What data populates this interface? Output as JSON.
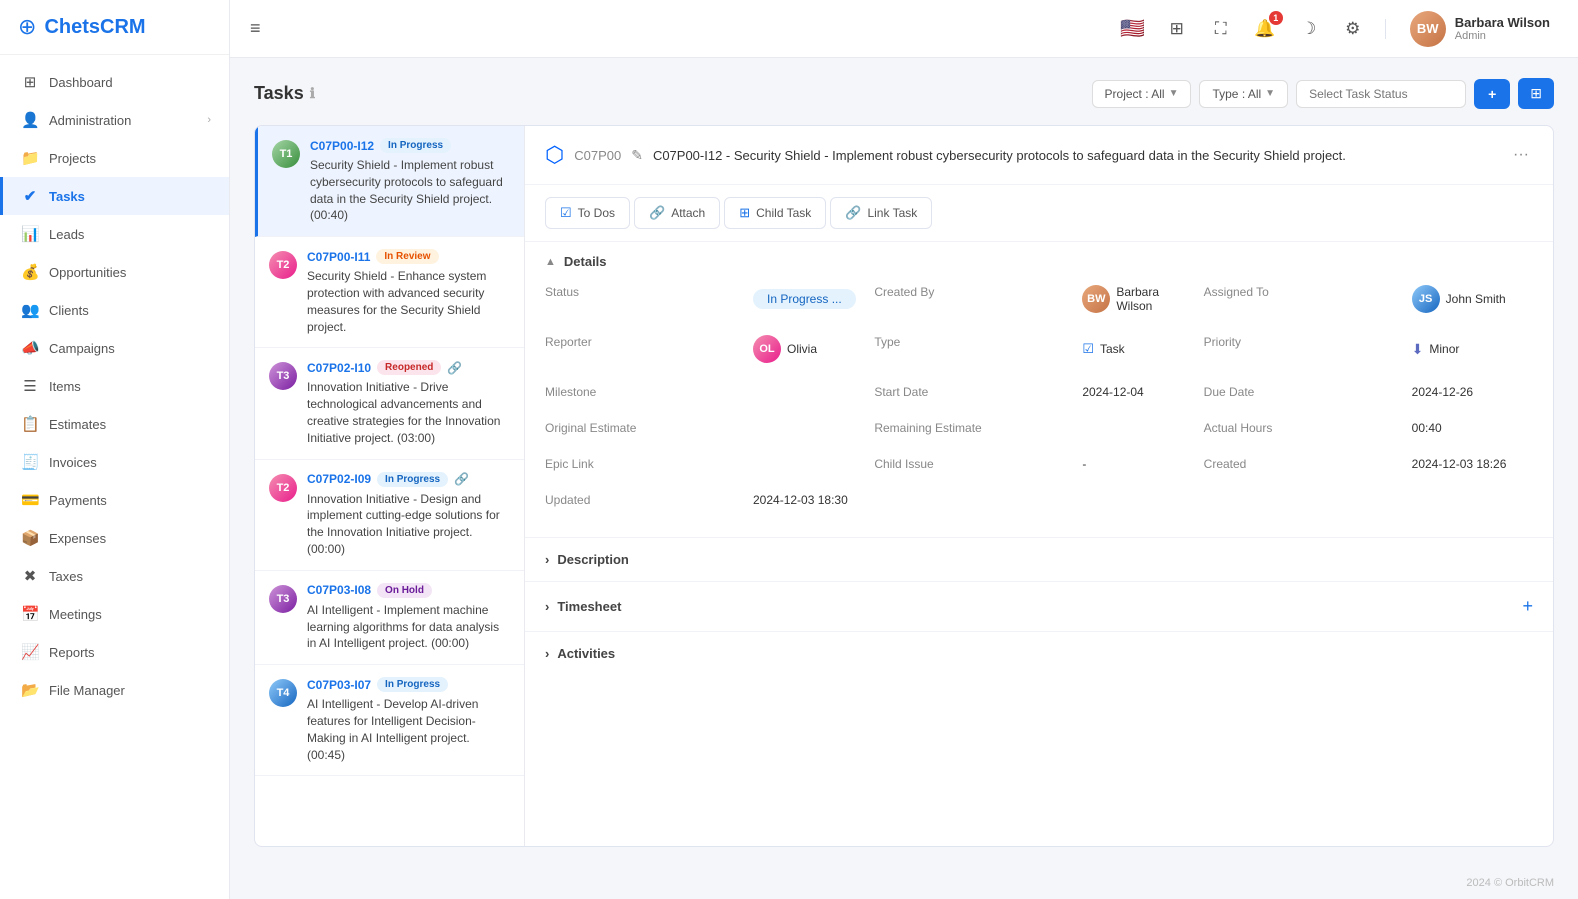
{
  "app": {
    "name": "ChetsCRM",
    "logo_symbol": "⊕"
  },
  "topbar": {
    "hamburger": "≡",
    "user": {
      "name": "Barbara Wilson",
      "role": "Admin",
      "initials": "BW"
    },
    "notification_count": "1"
  },
  "sidebar": {
    "items": [
      {
        "id": "dashboard",
        "label": "Dashboard",
        "icon": "⊞"
      },
      {
        "id": "administration",
        "label": "Administration",
        "icon": "👤",
        "has_arrow": true
      },
      {
        "id": "projects",
        "label": "Projects",
        "icon": "📁"
      },
      {
        "id": "tasks",
        "label": "Tasks",
        "icon": "✔",
        "active": true
      },
      {
        "id": "leads",
        "label": "Leads",
        "icon": "📊"
      },
      {
        "id": "opportunities",
        "label": "Opportunities",
        "icon": "💰"
      },
      {
        "id": "clients",
        "label": "Clients",
        "icon": "👥"
      },
      {
        "id": "campaigns",
        "label": "Campaigns",
        "icon": "📣"
      },
      {
        "id": "items",
        "label": "Items",
        "icon": "☰"
      },
      {
        "id": "estimates",
        "label": "Estimates",
        "icon": "📋"
      },
      {
        "id": "invoices",
        "label": "Invoices",
        "icon": "🧾"
      },
      {
        "id": "payments",
        "label": "Payments",
        "icon": "💳"
      },
      {
        "id": "expenses",
        "label": "Expenses",
        "icon": "📦"
      },
      {
        "id": "taxes",
        "label": "Taxes",
        "icon": "✖"
      },
      {
        "id": "meetings",
        "label": "Meetings",
        "icon": "📅"
      },
      {
        "id": "reports",
        "label": "Reports",
        "icon": "📈"
      },
      {
        "id": "file-manager",
        "label": "File Manager",
        "icon": "📂"
      }
    ]
  },
  "tasks_page": {
    "title": "Tasks",
    "info_icon": "ℹ",
    "filter_project": "Project : All",
    "filter_type": "Type : All",
    "search_placeholder": "Select Task Status",
    "btn_add": "+",
    "btn_grid": "⊞"
  },
  "task_list": [
    {
      "id": "C07P00-I12",
      "badge": "In Progress",
      "badge_class": "badge-in-progress",
      "text": "Security Shield - Implement robust cybersecurity protocols to safeguard data in the Security Shield project. (00:40)",
      "avatar_initials": "T1",
      "avatar_class": "avatar-task1",
      "has_link": false,
      "selected": true
    },
    {
      "id": "C07P00-I11",
      "badge": "In Review",
      "badge_class": "badge-in-review",
      "text": "Security Shield - Enhance system protection with advanced security measures for the Security Shield project.",
      "avatar_initials": "T2",
      "avatar_class": "avatar-task2",
      "has_link": false,
      "selected": false
    },
    {
      "id": "C07P02-I10",
      "badge": "Reopened",
      "badge_class": "badge-reopened",
      "text": "Innovation Initiative - Drive technological advancements and creative strategies for the Innovation Initiative project. (03:00)",
      "avatar_initials": "T3",
      "avatar_class": "avatar-task3",
      "has_link": true,
      "selected": false
    },
    {
      "id": "C07P02-I09",
      "badge": "In Progress",
      "badge_class": "badge-in-progress",
      "text": "Innovation Initiative - Design and implement cutting-edge solutions for the Innovation Initiative project. (00:00)",
      "avatar_initials": "T2",
      "avatar_class": "avatar-task2",
      "has_link": true,
      "selected": false
    },
    {
      "id": "C07P03-I08",
      "badge": "On Hold",
      "badge_class": "badge-on-hold",
      "text": "AI Intelligent - Implement machine learning algorithms for data analysis in AI Intelligent project. (00:00)",
      "avatar_initials": "T3",
      "avatar_class": "avatar-task3",
      "has_link": false,
      "selected": false
    },
    {
      "id": "C07P03-I07",
      "badge": "In Progress",
      "badge_class": "badge-in-progress",
      "text": "AI Intelligent - Develop AI-driven features for Intelligent Decision-Making in AI Intelligent project. (00:45)",
      "avatar_initials": "T4",
      "avatar_class": "avatar-task4",
      "has_link": false,
      "selected": false
    }
  ],
  "task_detail": {
    "project_id": "C07P00",
    "title": "C07P00-I12 - Security Shield - Implement robust cybersecurity protocols to safeguard data in the Security Shield project.",
    "tabs": [
      {
        "id": "todos",
        "label": "To Dos",
        "icon": "☑"
      },
      {
        "id": "attach",
        "label": "Attach",
        "icon": "🔗"
      },
      {
        "id": "child-task",
        "label": "Child Task",
        "icon": "⊞"
      },
      {
        "id": "link-task",
        "label": "Link Task",
        "icon": "🔗"
      }
    ],
    "details_section": {
      "label": "Details",
      "fields": {
        "status_label": "Status",
        "status_value": "In Progress ...",
        "created_by_label": "Created By",
        "created_by_value": "Barbara Wilson",
        "assigned_to_label": "Assigned To",
        "assigned_to_value": "John Smith",
        "reporter_label": "Reporter",
        "reporter_value": "Olivia",
        "type_label": "Type",
        "type_value": "Task",
        "priority_label": "Priority",
        "priority_value": "Minor",
        "milestone_label": "Milestone",
        "milestone_value": "",
        "start_date_label": "Start Date",
        "start_date_value": "2024-12-04",
        "due_date_label": "Due Date",
        "due_date_value": "2024-12-26",
        "original_estimate_label": "Original Estimate",
        "original_estimate_value": "",
        "remaining_estimate_label": "Remaining Estimate",
        "remaining_estimate_value": "",
        "actual_hours_label": "Actual Hours",
        "actual_hours_value": "00:40",
        "epic_link_label": "Epic Link",
        "epic_link_value": "",
        "child_issue_label": "Child Issue",
        "child_issue_value": "-",
        "created_label": "Created",
        "created_value": "2024-12-03 18:26",
        "updated_label": "Updated",
        "updated_value": "2024-12-03 18:30"
      }
    },
    "description_section": "Description",
    "timesheet_section": "Timesheet",
    "activities_section": "Activities"
  },
  "footer": {
    "text": "2024 © OrbitCRM"
  }
}
